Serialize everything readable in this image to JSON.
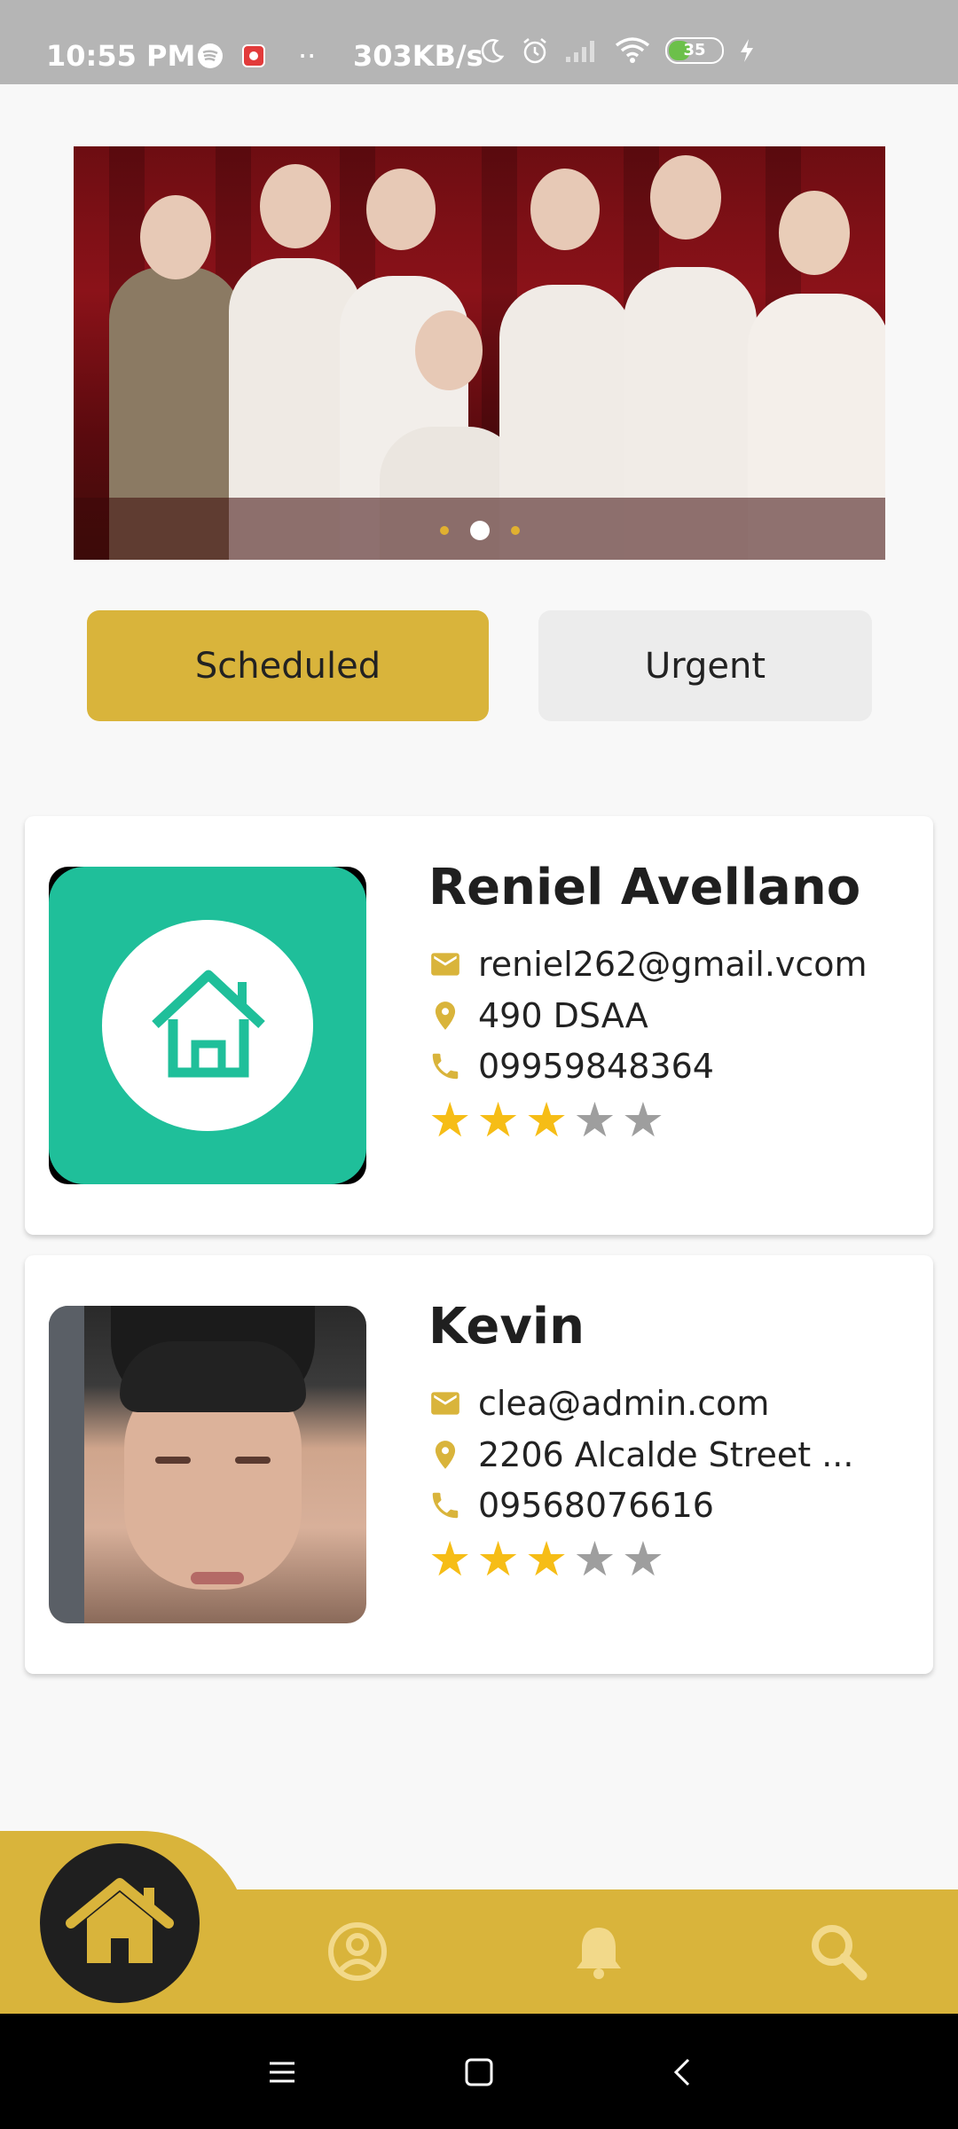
{
  "status_bar": {
    "time": "10:55 PM",
    "speed": "303KB/s",
    "battery": "35",
    "icons": [
      "spotify-icon",
      "app-notification-icon",
      "more-dots-icon",
      "moon-icon",
      "alarm-icon",
      "signal-icon",
      "wifi-icon",
      "battery-icon",
      "charging-icon"
    ]
  },
  "banner": {
    "slides": 3,
    "active_slide": 1
  },
  "tabs": {
    "scheduled_label": "Scheduled",
    "urgent_label": "Urgent",
    "active": "Scheduled"
  },
  "cards": [
    {
      "name": "Reniel Avellano",
      "email": "reniel262@gmail.vcom",
      "address": "490 DSAA",
      "phone": "09959848364",
      "rating": 3,
      "rating_max": 5,
      "avatar": "home-app-logo"
    },
    {
      "name": "Kevin",
      "email": "clea@admin.com",
      "address": "2206 Alcalde Street ...",
      "phone": "09568076616",
      "rating": 3,
      "rating_max": 5,
      "avatar": "profile-photo"
    }
  ],
  "bottom_nav": {
    "items": [
      "home-icon",
      "profile-icon",
      "bell-icon",
      "search-icon"
    ],
    "active": "home-icon"
  },
  "colors": {
    "accent": "#d9b43b",
    "star_on": "#f6bd16",
    "star_off": "#9e9e9e",
    "urgent_bg": "#ececec"
  }
}
